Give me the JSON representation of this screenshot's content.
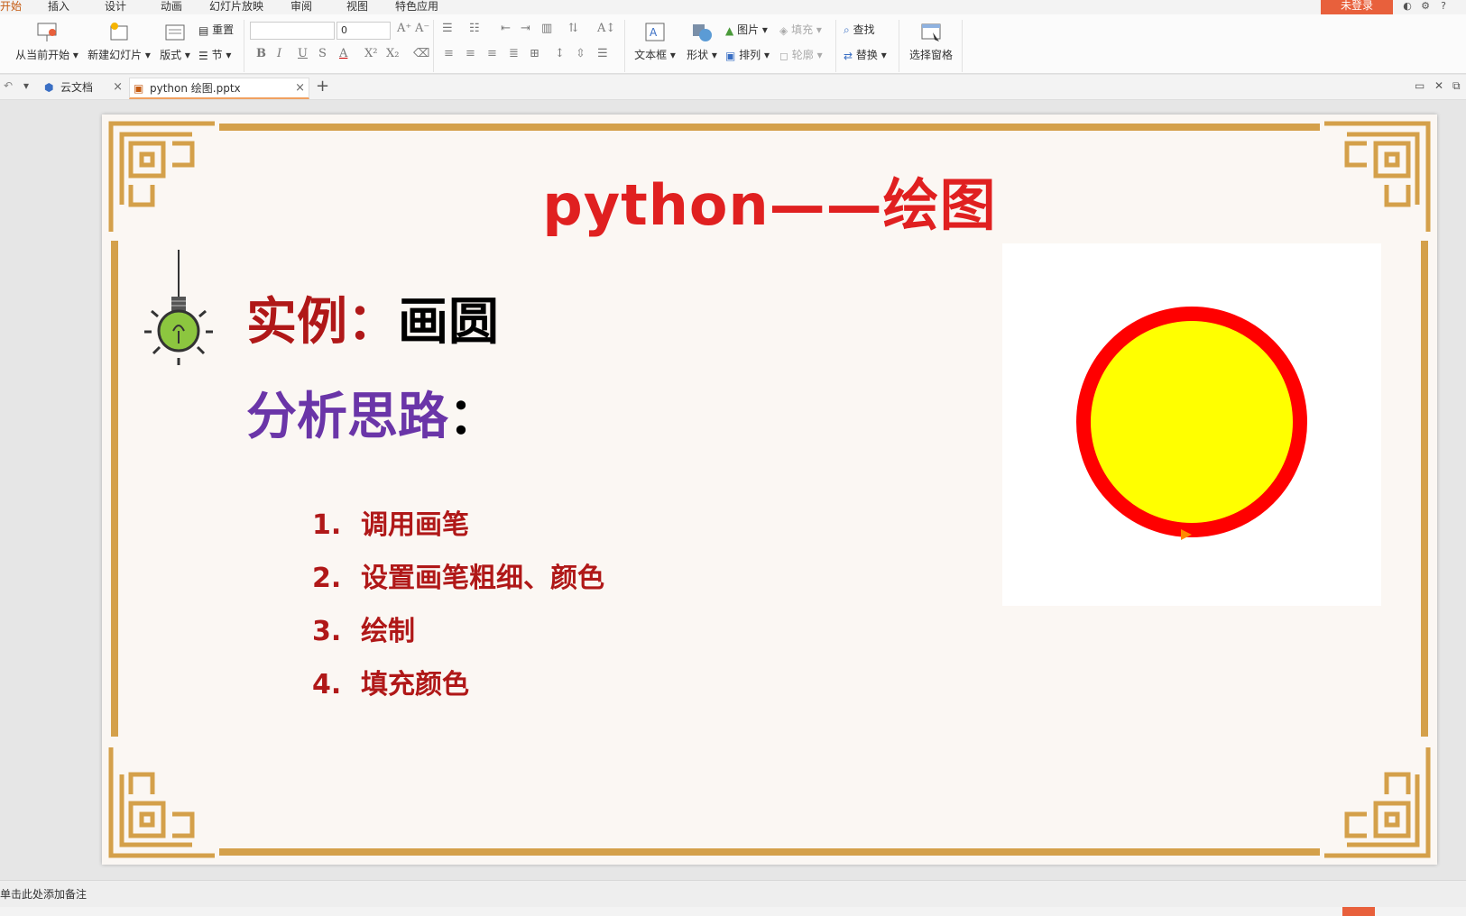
{
  "menu_tabs": [
    "开始",
    "插入",
    "设计",
    "动画",
    "幻灯片放映",
    "审阅",
    "视图",
    "特色应用"
  ],
  "login_label": "未登录",
  "ribbon": {
    "start_from_current": "从当前开始",
    "new_slide": "新建幻灯片",
    "layout": "版式",
    "reset": "重置",
    "section": "节",
    "font_size_value": "0",
    "textbox": "文本框",
    "shape": "形状",
    "picture": "图片",
    "fill": "填充",
    "arrange": "排列",
    "outline": "轮廓",
    "find": "查找",
    "replace": "替换",
    "select_pane": "选择窗格"
  },
  "tabs": {
    "cloud_docs": "云文档",
    "active_file": "python 绘图.pptx"
  },
  "slide": {
    "title": "python——绘图",
    "example_label": "实例：",
    "example_value": "画圆",
    "analysis_label": "分析思路",
    "analysis_colon": "：",
    "steps": [
      {
        "num": "1.",
        "text": "调用画笔"
      },
      {
        "num": "2.",
        "text": "设置画笔粗细、颜色"
      },
      {
        "num": "3.",
        "text": "绘制"
      },
      {
        "num": "4.",
        "text": "填充颜色"
      }
    ],
    "circle_fill": "#ffff00",
    "circle_stroke": "#ff0000"
  },
  "notes_placeholder": "单击此处添加备注",
  "colors": {
    "frame_gold": "#d4a04a",
    "title_red": "#e02020",
    "label_dark_red": "#b01818",
    "analysis_purple": "#6a35a8",
    "accent_orange": "#e8603c"
  }
}
